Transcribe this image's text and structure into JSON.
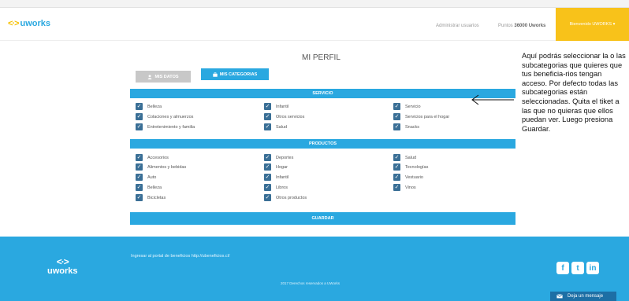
{
  "header": {
    "logo_mark": "<·>",
    "logo_text": "uworks",
    "admin_link": "Administrar usuarios",
    "points_label": "Puntos",
    "points_value": "36000 Uworks",
    "welcome": "Bienvenido UWORKS ▾"
  },
  "main": {
    "title": "MI PERFIL",
    "tabs": [
      {
        "label": "MIS DATOS",
        "icon": "user-icon"
      },
      {
        "label": "MIS CATEGORIAS",
        "icon": "briefcase-icon"
      }
    ],
    "sections": {
      "servicio": {
        "title": "SERVICIO",
        "items": [
          "Belleza",
          "Colaciones y almuerzos",
          "Entretenimiento y familia",
          "Infantil",
          "Otros servicios",
          "Salud",
          "Servicio",
          "Servicios para el hogar",
          "Snacks"
        ]
      },
      "productos": {
        "title": "PRODUCTOS",
        "items": [
          "Accesorios",
          "Alimentos y bebidas",
          "Auto",
          "Belleza",
          "Bicicletas",
          "Deportes",
          "Hogar",
          "Infantil",
          "Libros",
          "Otros productos",
          "Salud",
          "Tecnologías",
          "Vestuario",
          "Vinos"
        ]
      }
    },
    "save_label": "GUARDAR"
  },
  "annotation": {
    "text": "Aquí podrás seleccionar la o las subcategorias que quieres que tus beneficia-rios tengan acceso. Por defecto todas las subcategorias están seleccionadas. Quita el tiket a las que no quieras que ellos puedan ver. Luego presiona Guardar."
  },
  "footer": {
    "logo_text": "uworks",
    "portal_link": "Ingresar al portal de beneficios http://ubeneficios.cl/",
    "copyright": "2017 Derechos reservados a UWorks",
    "social": [
      "f",
      "t",
      "in"
    ],
    "message_button": "Deja un mensaje"
  },
  "colors": {
    "accent_blue": "#2aa8e0",
    "accent_yellow": "#f8c21a",
    "checkbox": "#3a6f96"
  }
}
